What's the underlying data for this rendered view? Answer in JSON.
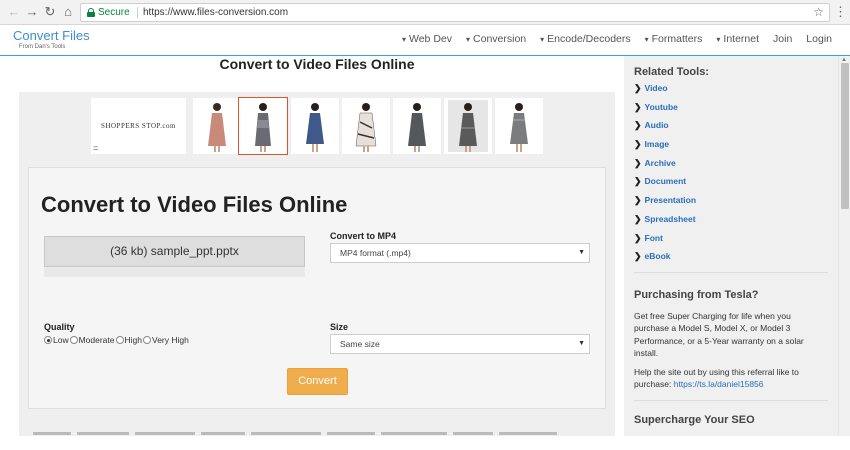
{
  "browser": {
    "secure_label": "Secure",
    "url": "https://www.files-conversion.com",
    "back_glyph": "←",
    "forward_glyph": "→",
    "reload_glyph": "↻",
    "home_glyph": "⌂",
    "star_glyph": "☆",
    "menu_glyph": "⋮"
  },
  "header": {
    "logo_title": "Convert Files",
    "logo_subtitle": "From Dan's Tools",
    "nav": [
      {
        "label": "Web Dev",
        "has_caret": true
      },
      {
        "label": "Conversion",
        "has_caret": true
      },
      {
        "label": "Encode/Decoders",
        "has_caret": true
      },
      {
        "label": "Formatters",
        "has_caret": true
      },
      {
        "label": "Internet",
        "has_caret": true
      },
      {
        "label": "Join",
        "has_caret": false
      },
      {
        "label": "Login",
        "has_caret": false
      }
    ],
    "caret_glyph": "▾"
  },
  "main": {
    "page_heading": "Convert to Video Files Online",
    "ad": {
      "brand": "SHOPPERS STOP.com",
      "eq_glyph": "=",
      "dress_colors": [
        "#c98a7a",
        "#6a6a72",
        "#3f5a8a",
        "#e8e0d8",
        "#55575c",
        "#5a5a5a",
        "#7a7d80"
      ]
    },
    "card": {
      "title": "Convert to Video Files Online",
      "file_label": "(36 kb) sample_ppt.pptx",
      "convert_to_label": "Convert to MP4",
      "format_value": "MP4 format (.mp4)",
      "quality_label": "Quality",
      "quality_options": [
        "Low",
        "Moderate",
        "High",
        "Very High"
      ],
      "quality_selected": "Low",
      "size_label": "Size",
      "size_value": "Same size",
      "convert_button": "Convert",
      "select_arrow": "▼"
    }
  },
  "sidebar": {
    "related_heading": "Related Tools:",
    "chevron_glyph": "❯",
    "tools": [
      "Video",
      "Youtube",
      "Audio",
      "Image",
      "Archive",
      "Document",
      "Presentation",
      "Spreadsheet",
      "Font",
      "eBook"
    ],
    "tesla_heading": "Purchasing from Tesla?",
    "tesla_text": "Get free Super Charging for life when you purchase a Model S, Model X, or Model 3 Performance, or a 5-Year warranty on a solar install.",
    "tesla_help": "Help the site out by using this referral like to purchase:",
    "tesla_link": "https://ts.la/daniel15856",
    "seo_heading": "Supercharge Your SEO"
  },
  "colors": {
    "accent": "#3aa3d6",
    "link": "#2a6ebb",
    "button": "#f0ad4e",
    "secure": "#0b8043"
  }
}
